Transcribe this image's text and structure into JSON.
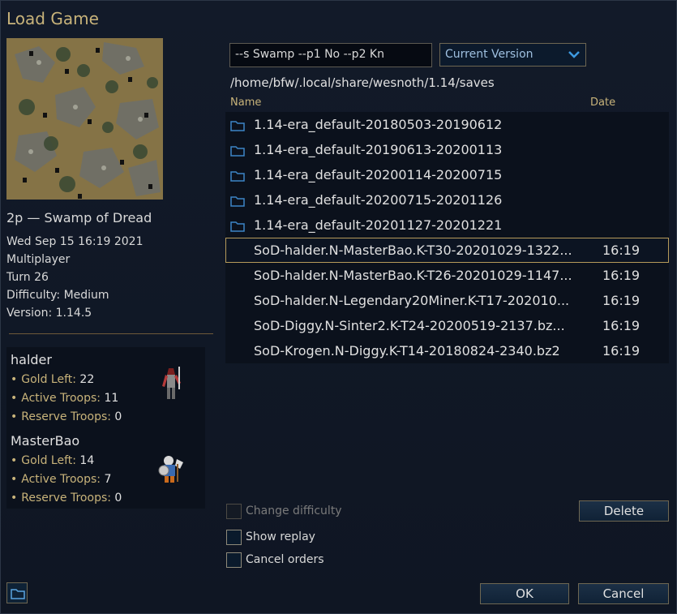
{
  "window": {
    "title": "Load Game"
  },
  "left": {
    "scenario": "2p — Swamp of Dread",
    "date": "Wed Sep 15 16:19 2021",
    "mode": "Multiplayer",
    "turn": "Turn 26",
    "difficulty": "Difficulty: Medium",
    "version": "Version: 1.14.5",
    "players": [
      {
        "name": "halder",
        "gold_label": "Gold Left:",
        "gold": "22",
        "active_label": "Active Troops:",
        "active": "11",
        "reserve_label": "Reserve Troops:",
        "reserve": "0"
      },
      {
        "name": "MasterBao",
        "gold_label": "Gold Left:",
        "gold": "14",
        "active_label": "Active Troops:",
        "active": "7",
        "reserve_label": "Reserve Troops:",
        "reserve": "0"
      }
    ]
  },
  "filter": {
    "value": "--s Swamp --p1 No --p2 Kn"
  },
  "version_select": {
    "selected": "Current Version"
  },
  "path": "/home/bfw/.local/share/wesnoth/1.14/saves",
  "columns": {
    "name": "Name",
    "date": "Date"
  },
  "files": [
    {
      "name": "1.14-era_default-20180503-20190612",
      "date": "",
      "folder": true
    },
    {
      "name": "1.14-era_default-20190613-20200113",
      "date": "",
      "folder": true
    },
    {
      "name": "1.14-era_default-20200114-20200715",
      "date": "",
      "folder": true
    },
    {
      "name": "1.14-era_default-20200715-20201126",
      "date": "",
      "folder": true
    },
    {
      "name": "1.14-era_default-20201127-20201221",
      "date": "",
      "folder": true
    },
    {
      "name": "SoD-halder.N-MasterBao.K-T30-20201029-1322...",
      "date": "16:19",
      "folder": false,
      "selected": true
    },
    {
      "name": "SoD-halder.N-MasterBao.K-T26-20201029-1147...",
      "date": "16:19",
      "folder": false
    },
    {
      "name": "SoD-halder.N-Legendary20Miner.K-T17-202010...",
      "date": "16:19",
      "folder": false
    },
    {
      "name": "SoD-Diggy.N-Sinter2.K-T24-20200519-2137.bz...",
      "date": "16:19",
      "folder": false
    },
    {
      "name": "SoD-Krogen.N-Diggy.K-T14-20180824-2340.bz2",
      "date": "16:19",
      "folder": false
    }
  ],
  "options": {
    "change_difficulty": "Change difficulty",
    "show_replay": "Show replay",
    "cancel_orders": "Cancel orders"
  },
  "buttons": {
    "delete": "Delete",
    "ok": "OK",
    "cancel": "Cancel"
  },
  "icons": {
    "folder": "folder-icon",
    "dropdown": "chevron-down-icon",
    "open_dir": "open-folder-icon"
  },
  "colors": {
    "accent_gold": "#c8b37a",
    "selection_border": "#b69a5a",
    "folder_blue": "#3d86c6"
  }
}
